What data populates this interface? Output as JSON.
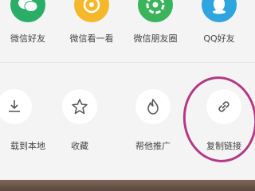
{
  "share_row": [
    {
      "label": "微信好友",
      "icon": "wechat-icon"
    },
    {
      "label": "微信看一看",
      "icon": "look-icon"
    },
    {
      "label": "微信朋友圈",
      "icon": "moments-icon"
    },
    {
      "label": "QQ好友",
      "icon": "qq-icon"
    }
  ],
  "action_row": [
    {
      "label": "载到本地",
      "icon": "download-icon"
    },
    {
      "label": "收藏",
      "icon": "star-icon"
    },
    {
      "label": "帮他推广",
      "icon": "flame-icon"
    },
    {
      "label": "复制链接",
      "icon": "link-icon"
    }
  ],
  "colors": {
    "wechat_green": "#2aae67",
    "look_yellow": "#f5b82a",
    "qq_blue": "#2fa5e0",
    "highlight_circle": "#b33a85"
  }
}
